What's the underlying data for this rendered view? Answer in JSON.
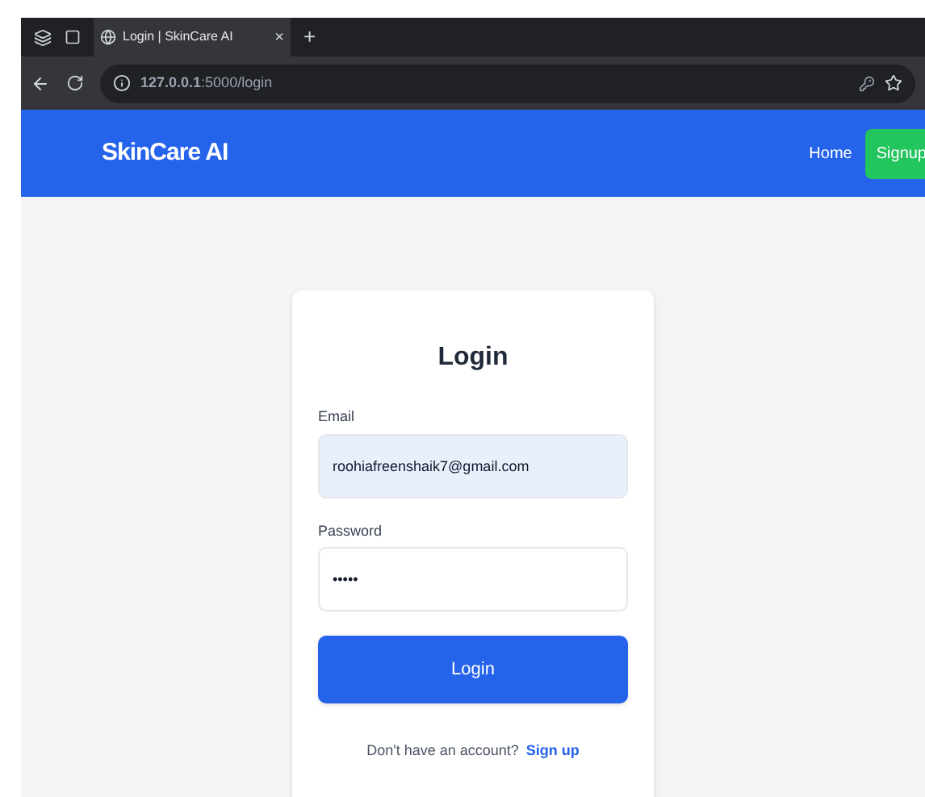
{
  "browser": {
    "tab_title": "Login | SkinCare AI",
    "tab_close": "×",
    "new_tab": "+",
    "address": "**127.0.0.1**:5000/login"
  },
  "navbar": {
    "brand": "SkinCare AI",
    "links": [
      {
        "label": "Home",
        "kind": "link"
      },
      {
        "label": "Signup",
        "kind": "button"
      }
    ]
  },
  "card": {
    "title": "Login",
    "fields": [
      {
        "label": "Email",
        "value": "roohiafreenshaik7@gmail.com",
        "autofilled": true
      },
      {
        "label": "Password",
        "value": "•••••",
        "autofilled": false
      }
    ],
    "submit": "Login",
    "footer_text": "Don't have an account?",
    "footer_link": "Sign up"
  }
}
